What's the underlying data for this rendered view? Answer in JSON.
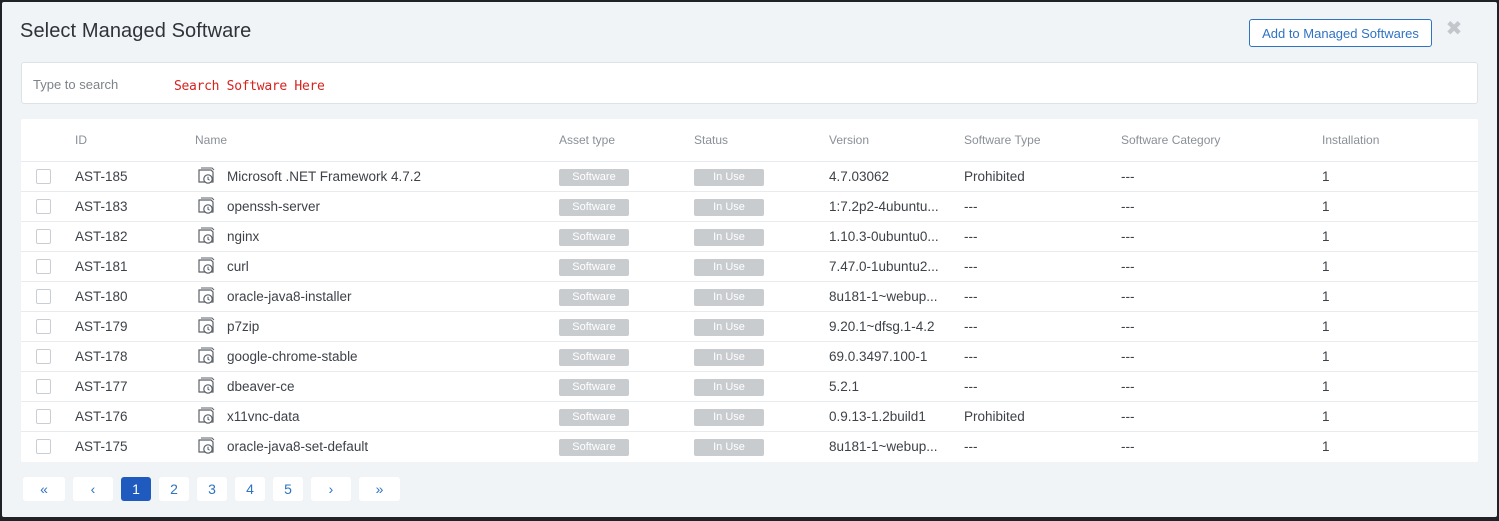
{
  "modal": {
    "title": "Select Managed Software",
    "add_button_label": "Add to Managed Softwares",
    "close_glyph": "✖"
  },
  "search": {
    "placeholder": "Type to search",
    "hint": "Search Software Here"
  },
  "table": {
    "headers": {
      "id": "ID",
      "name": "Name",
      "asset_type": "Asset type",
      "status": "Status",
      "version": "Version",
      "software_type": "Software Type",
      "software_category": "Software Category",
      "installation": "Installation"
    },
    "rows": [
      {
        "id": "AST-185",
        "name": "Microsoft .NET Framework 4.7.2",
        "asset_type": "Software",
        "status": "In Use",
        "version": "4.7.03062",
        "software_type": "Prohibited",
        "software_category": "---",
        "installation": "1"
      },
      {
        "id": "AST-183",
        "name": "openssh-server",
        "asset_type": "Software",
        "status": "In Use",
        "version": "1:7.2p2-4ubuntu...",
        "software_type": "---",
        "software_category": "---",
        "installation": "1"
      },
      {
        "id": "AST-182",
        "name": "nginx",
        "asset_type": "Software",
        "status": "In Use",
        "version": "1.10.3-0ubuntu0...",
        "software_type": "---",
        "software_category": "---",
        "installation": "1"
      },
      {
        "id": "AST-181",
        "name": "curl",
        "asset_type": "Software",
        "status": "In Use",
        "version": "7.47.0-1ubuntu2...",
        "software_type": "---",
        "software_category": "---",
        "installation": "1"
      },
      {
        "id": "AST-180",
        "name": "oracle-java8-installer",
        "asset_type": "Software",
        "status": "In Use",
        "version": "8u181-1~webup...",
        "software_type": "---",
        "software_category": "---",
        "installation": "1"
      },
      {
        "id": "AST-179",
        "name": "p7zip",
        "asset_type": "Software",
        "status": "In Use",
        "version": "9.20.1~dfsg.1-4.2",
        "software_type": "---",
        "software_category": "---",
        "installation": "1"
      },
      {
        "id": "AST-178",
        "name": "google-chrome-stable",
        "asset_type": "Software",
        "status": "In Use",
        "version": "69.0.3497.100-1",
        "software_type": "---",
        "software_category": "---",
        "installation": "1"
      },
      {
        "id": "AST-177",
        "name": "dbeaver-ce",
        "asset_type": "Software",
        "status": "In Use",
        "version": "5.2.1",
        "software_type": "---",
        "software_category": "---",
        "installation": "1"
      },
      {
        "id": "AST-176",
        "name": "x11vnc-data",
        "asset_type": "Software",
        "status": "In Use",
        "version": "0.9.13-1.2build1",
        "software_type": "Prohibited",
        "software_category": "---",
        "installation": "1"
      },
      {
        "id": "AST-175",
        "name": "oracle-java8-set-default",
        "asset_type": "Software",
        "status": "In Use",
        "version": "8u181-1~webup...",
        "software_type": "---",
        "software_category": "---",
        "installation": "1"
      }
    ],
    "row_icon": "software-package-icon"
  },
  "pagination": {
    "first": "«",
    "prev": "‹",
    "pages": [
      "1",
      "2",
      "3",
      "4",
      "5"
    ],
    "active_page": "1",
    "next": "›",
    "last": "»"
  },
  "colors": {
    "accent": "#2f73c2",
    "active_page": "#1f5bbf",
    "hint_red": "#d6231e",
    "badge_gray": "#c9cccf"
  }
}
